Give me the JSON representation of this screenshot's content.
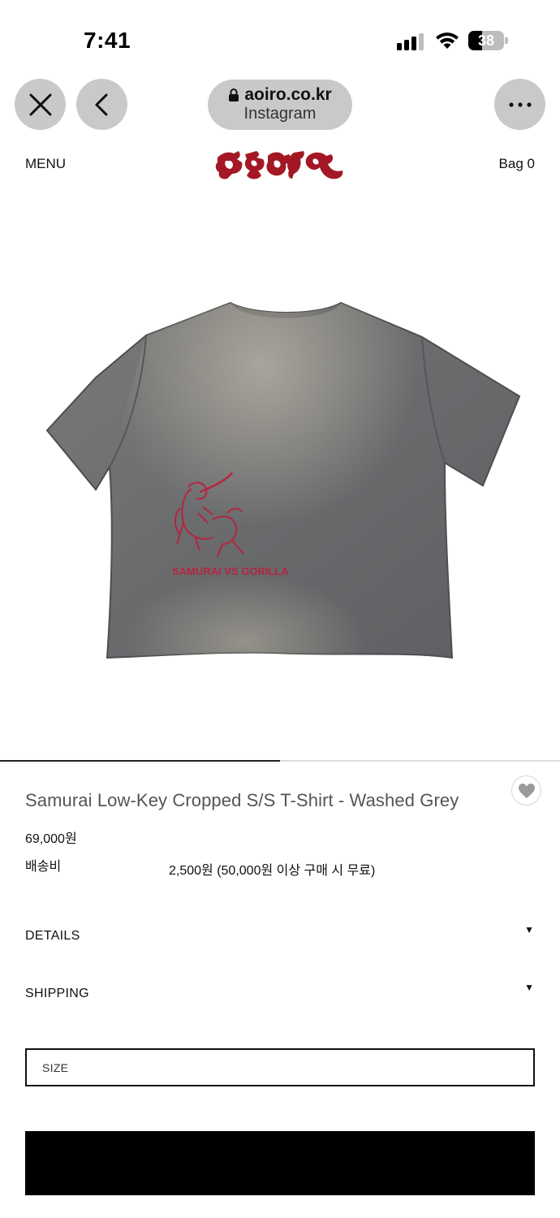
{
  "status_bar": {
    "time": "7:41",
    "battery": "38",
    "battery_percent": 38
  },
  "browser": {
    "url": "aoiro.co.kr",
    "source": "Instagram",
    "icons": [
      "close-icon",
      "back-icon",
      "lock-icon",
      "more-icon"
    ]
  },
  "header": {
    "menu_label": "MENU",
    "bag_label": "Bag",
    "bag_count": "0",
    "logo_color": "#a31824"
  },
  "gallery": {
    "progress_percent": 50
  },
  "product": {
    "title": "Samurai Low-Key Cropped S/S T-Shirt - Washed Grey",
    "price": "69,000원",
    "shipping_label": "배송비",
    "shipping_value": "2,500원 (50,000원 이상 구매 시 무료)",
    "details_label": "DETAILS",
    "shipping_section_label": "SHIPPING",
    "size_placeholder": "SIZE",
    "buy_label": ""
  },
  "colors": {
    "shirt_grey": "#6d6d6d",
    "print_red": "#b42640",
    "chrome_grey": "#c9c9c9",
    "button_black": "#000000"
  }
}
